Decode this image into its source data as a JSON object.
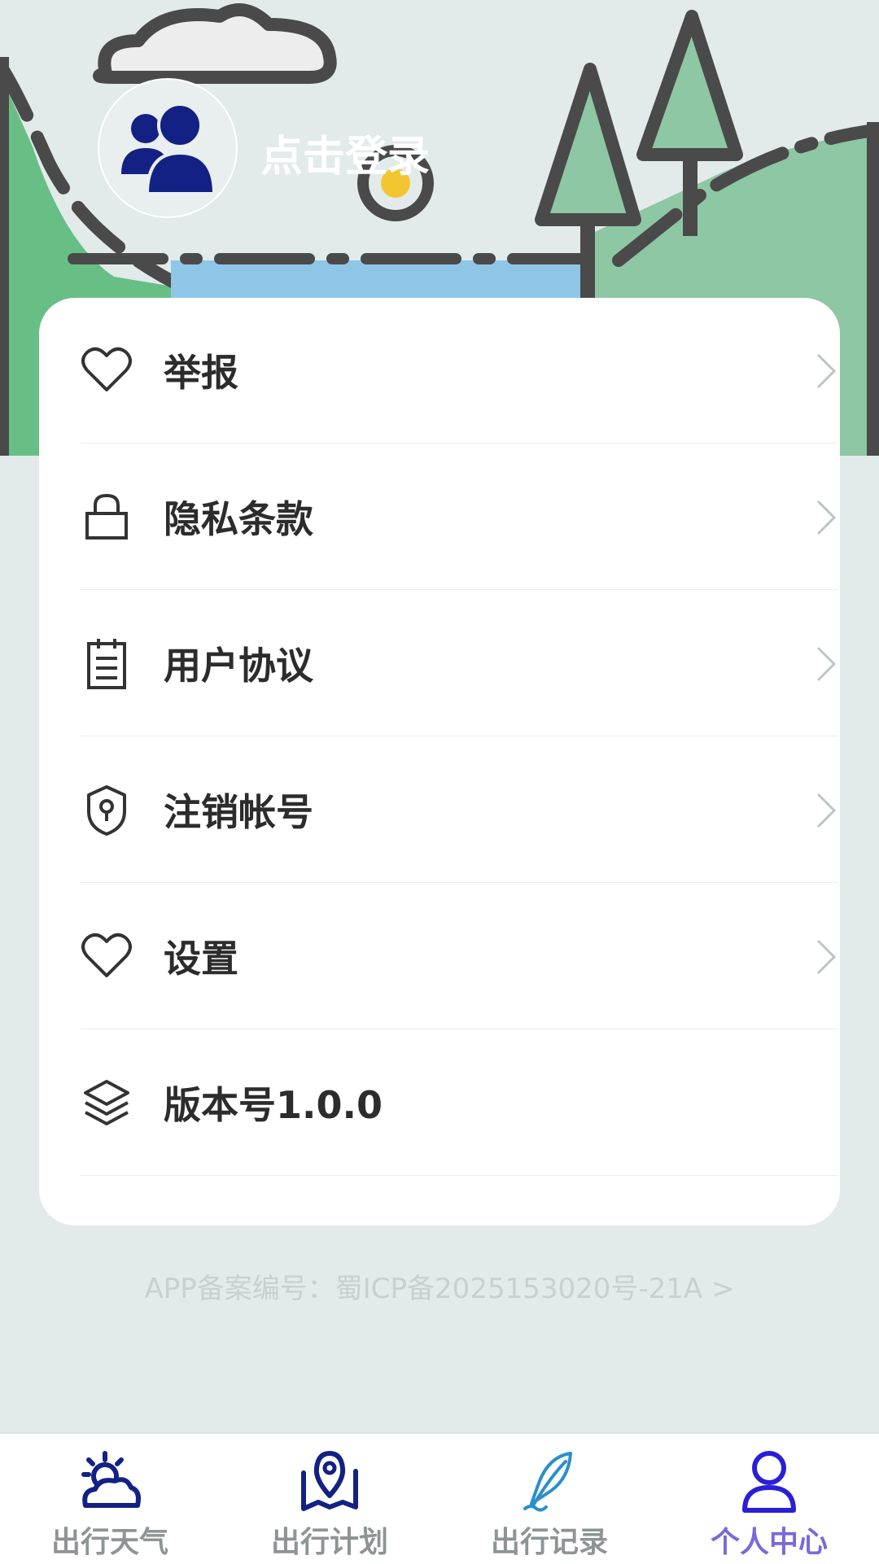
{
  "header": {
    "login_label": "点击登录"
  },
  "menu": [
    {
      "label": "举报",
      "icon": "heart-icon"
    },
    {
      "label": "隐私条款",
      "icon": "lock-icon"
    },
    {
      "label": "用户协议",
      "icon": "document-icon"
    },
    {
      "label": "注销帐号",
      "icon": "shield-icon"
    },
    {
      "label": "设置",
      "icon": "heart-icon"
    },
    {
      "label": "版本号1.0.0",
      "icon": "layers-icon"
    }
  ],
  "footer": {
    "icp": "APP备案编号：蜀ICP备2025153020号-21A >"
  },
  "tabs": [
    {
      "label": "出行天气",
      "icon": "weather-icon"
    },
    {
      "label": "出行计划",
      "icon": "map-pin-icon"
    },
    {
      "label": "出行记录",
      "icon": "feather-icon"
    },
    {
      "label": "个人中心",
      "icon": "person-icon",
      "active": true
    }
  ],
  "colors": {
    "accent": "#7b68d9",
    "avatar": "#132184",
    "background": "#e2ebe9"
  }
}
